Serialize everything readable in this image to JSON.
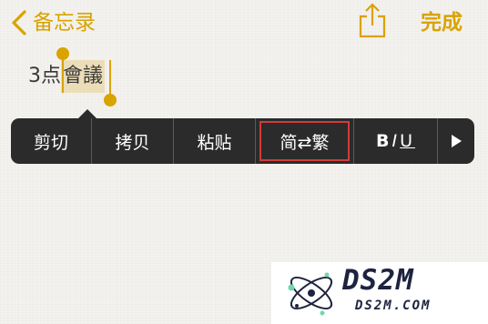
{
  "nav": {
    "back_label": "备忘录",
    "done_label": "完成",
    "back_icon": "chevron-left-icon",
    "share_icon": "share-icon"
  },
  "note": {
    "plain_text": "3点",
    "selected_text": "會議"
  },
  "edit_menu": {
    "items": [
      "剪切",
      "拷贝",
      "粘贴",
      "简⇄繁"
    ],
    "format": {
      "b": "B",
      "i": "I",
      "u": "U"
    },
    "more_icon": "triangle-right-icon",
    "highlighted_item": "简⇄繁"
  },
  "watermark": {
    "title": "DS2M",
    "domain": "DS2M.COM"
  },
  "colors": {
    "accent": "#d9a300",
    "menu_bg": "#2b2b2b",
    "highlight_box": "#d23a3a",
    "paper": "#f4f2ee"
  }
}
